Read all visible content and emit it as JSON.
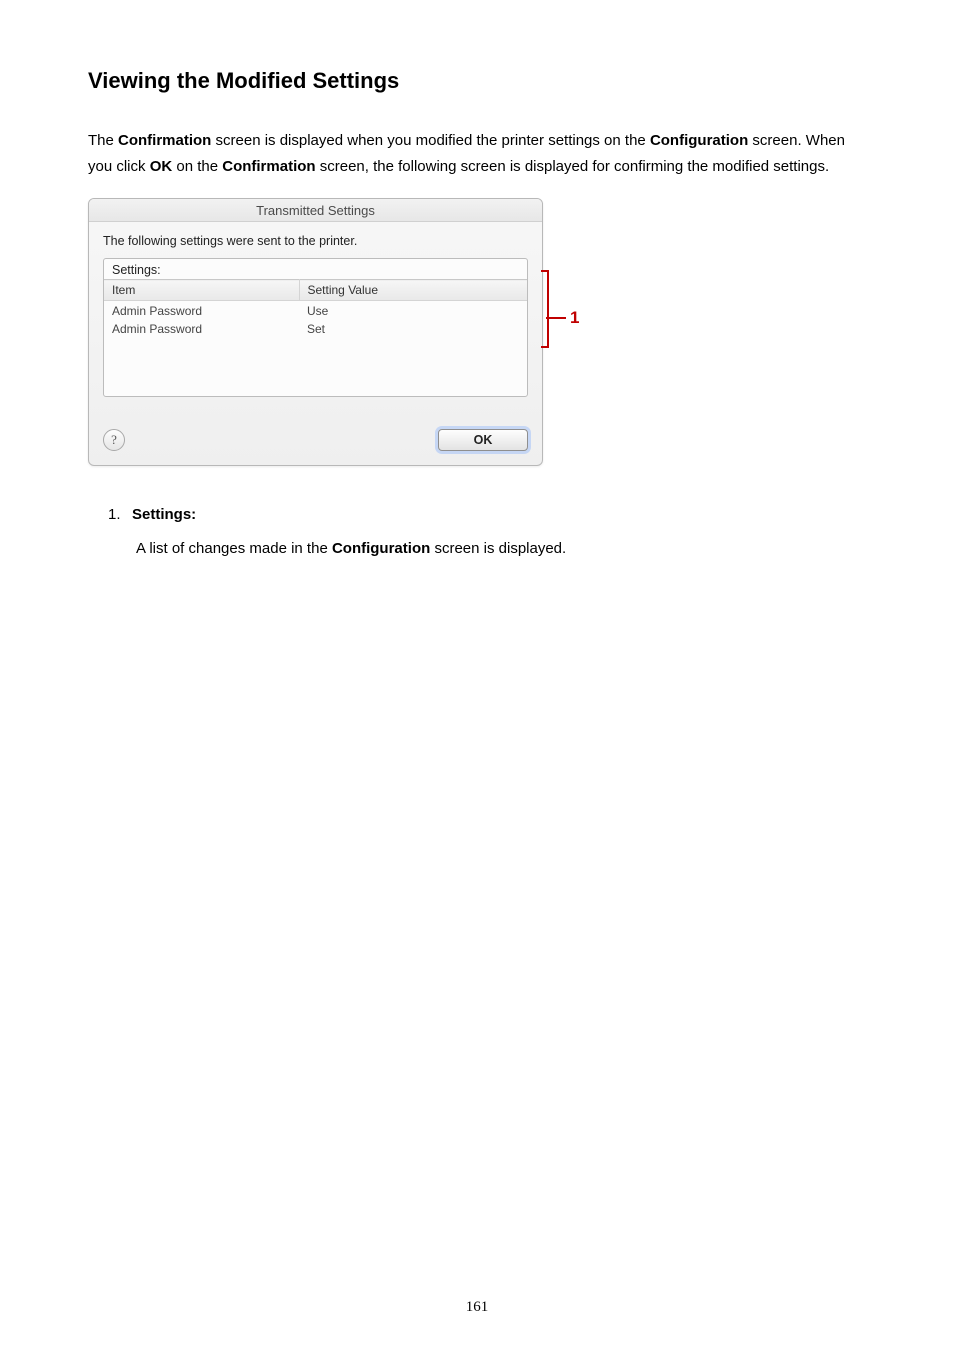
{
  "heading": "Viewing the Modified Settings",
  "intro": {
    "pre1": "The ",
    "b1": "Confirmation",
    "mid1": " screen is displayed when you modified the printer settings on the ",
    "b2": "Configuration",
    "post1": " screen. When you click ",
    "b3": "OK",
    "mid2": " on the ",
    "b4": "Confirmation",
    "post2": " screen, the following screen is displayed for confirming the modified settings."
  },
  "dialog": {
    "title": "Transmitted Settings",
    "message": "The following settings were sent to the printer.",
    "settings_label": "Settings:",
    "columns": {
      "item": "Item",
      "value": "Setting Value"
    },
    "rows": [
      {
        "item": "Admin Password",
        "value": "Use"
      },
      {
        "item": "Admin Password",
        "value": "Set"
      }
    ],
    "help_glyph": "?",
    "ok_label": "OK"
  },
  "callout": {
    "num": "1"
  },
  "explain": {
    "num": "1.",
    "title": "Settings:",
    "body_pre": "A list of changes made in the ",
    "body_b": "Configuration",
    "body_post": " screen is displayed."
  },
  "page_number": "161"
}
